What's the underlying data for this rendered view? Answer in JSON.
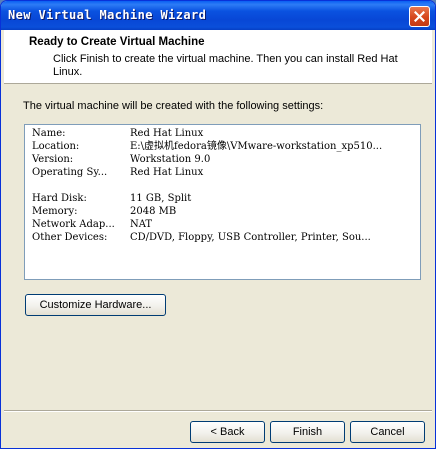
{
  "window": {
    "title": "New Virtual Machine Wizard"
  },
  "header": {
    "title": "Ready to Create Virtual Machine",
    "subtitle": "Click Finish to create the virtual machine. Then you can install Red Hat Linux."
  },
  "main": {
    "info_text": "The virtual machine will be created with the following settings:",
    "settings": [
      {
        "key": "Name:",
        "value": "Red Hat Linux"
      },
      {
        "key": "Location:",
        "value": "E:\\虚拟机fedora镜像\\VMware-workstation_xp510..."
      },
      {
        "key": "Version:",
        "value": "Workstation 9.0"
      },
      {
        "key": "Operating Sy...",
        "value": "Red Hat Linux"
      },
      {
        "key": "Hard Disk:",
        "value": "11 GB, Split"
      },
      {
        "key": "Memory:",
        "value": "2048 MB"
      },
      {
        "key": "Network Adap...",
        "value": "NAT"
      },
      {
        "key": "Other Devices:",
        "value": "CD/DVD, Floppy, USB Controller, Printer, Sou..."
      }
    ],
    "customize_label": "Customize Hardware..."
  },
  "footer": {
    "back_label": "< Back",
    "finish_label": "Finish",
    "cancel_label": "Cancel"
  },
  "colors": {
    "titlebar": "#0a52e0",
    "face": "#ece9d8",
    "close": "#d6461b"
  },
  "icons": {
    "close": "close-icon"
  }
}
